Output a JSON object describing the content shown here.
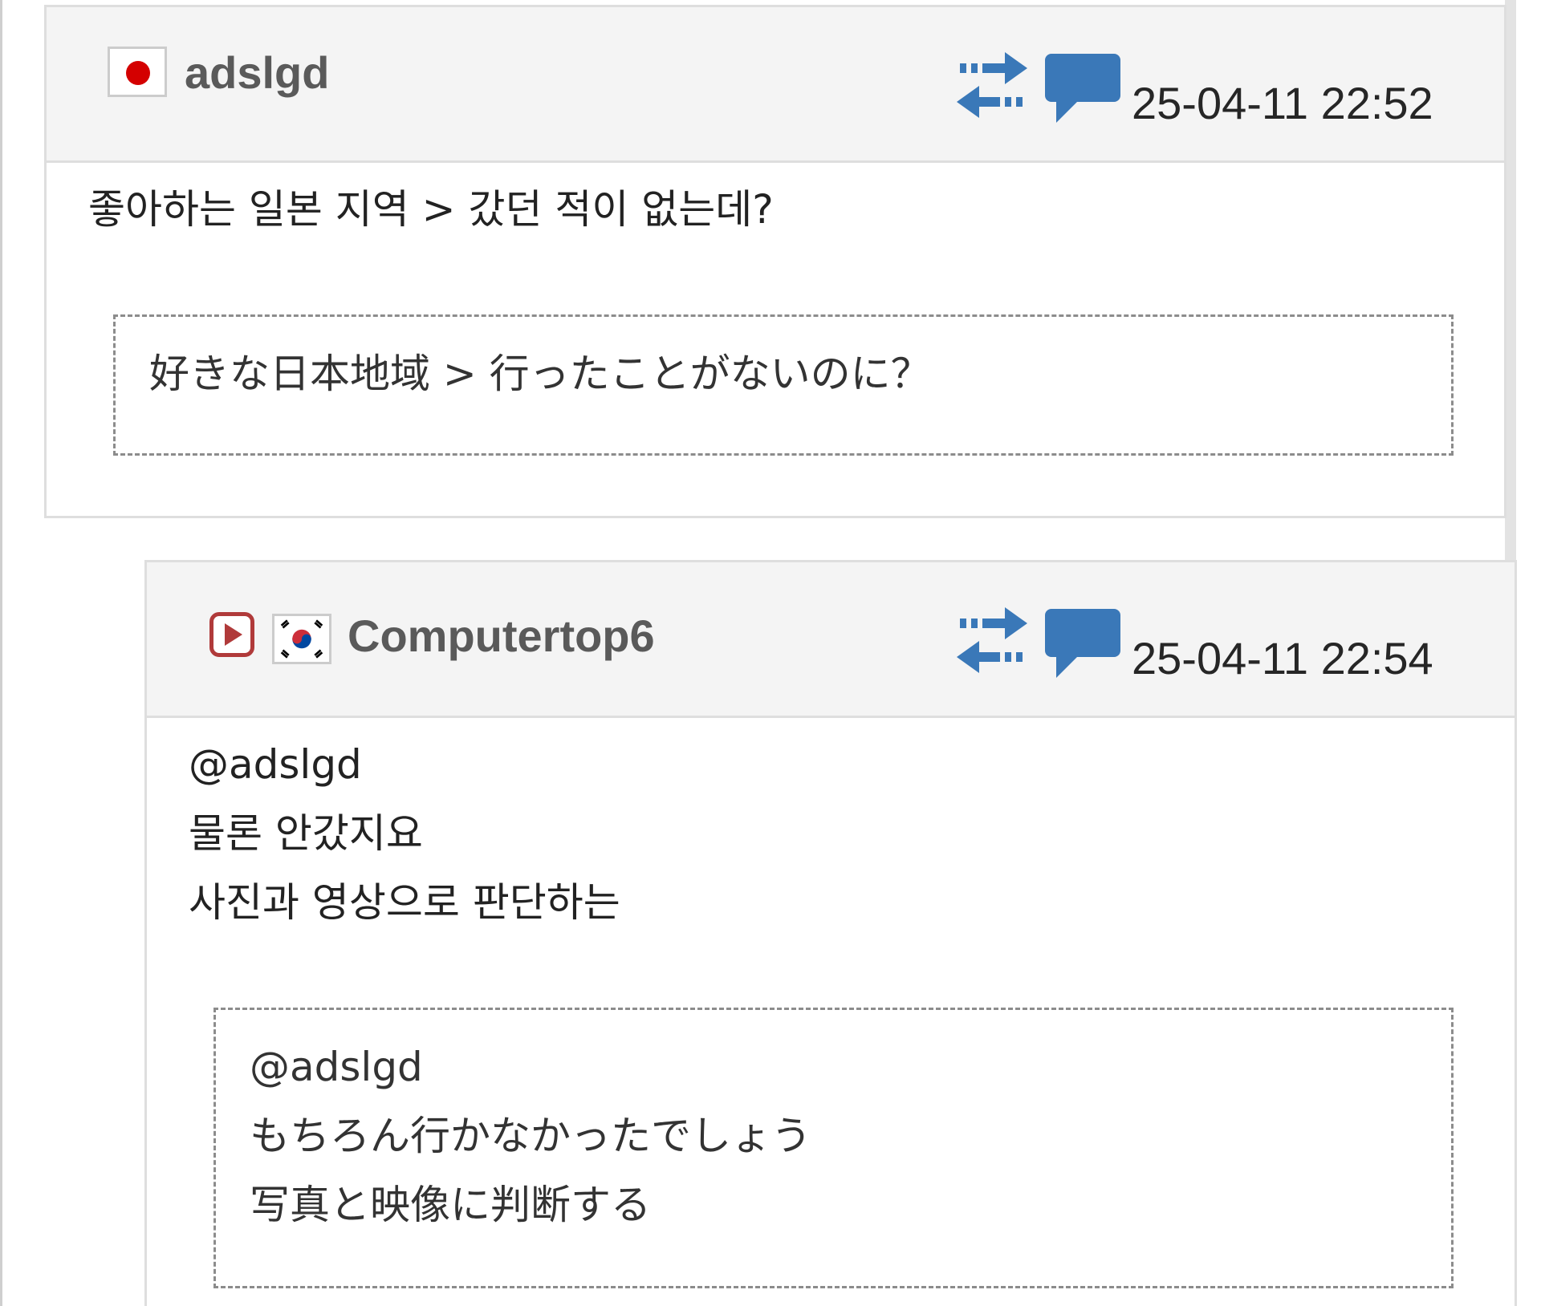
{
  "comments": [
    {
      "author": "adslgd",
      "country_flag": "japan-flag",
      "timestamp": "25-04-11 22:52",
      "text_lines": [
        "좋아하는 일본 지역 > 갔던 적이 없는데?"
      ],
      "translation_lines": [
        "好きな日本地域 > 行ったことがないのに？"
      ]
    },
    {
      "author": "Computertop6",
      "country_flag": "korea-flag",
      "badge": "video-play-icon",
      "timestamp": "25-04-11 22:54",
      "text_lines": [
        "@adslgd",
        "물론 안갔지요",
        "사진과 영상으로 판단하는"
      ],
      "translation_lines": [
        "@adslgd",
        "もちろん行かなかったでしょう",
        "写真と映像に判断する"
      ]
    }
  ],
  "icons": {
    "exchange": "exchange-arrows-icon",
    "reply": "speech-bubble-icon"
  },
  "colors": {
    "accent_blue": "#3a78b8",
    "header_bg": "#f4f4f4",
    "username_gray": "#5a5a5a",
    "badge_red": "#b03a3a",
    "japan_red": "#d40000"
  }
}
